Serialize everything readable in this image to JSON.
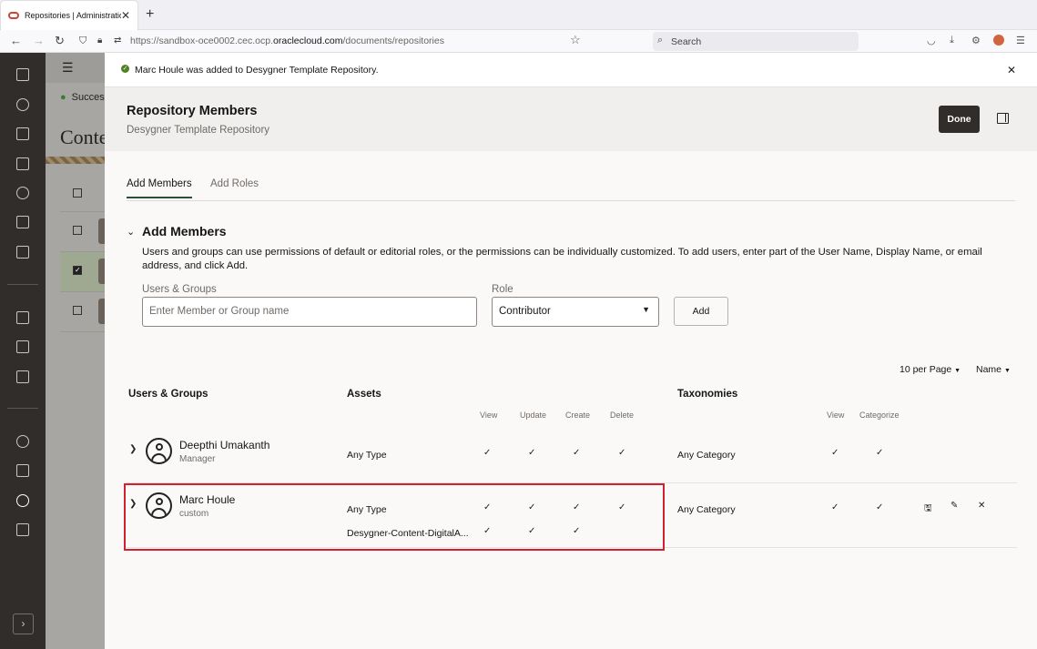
{
  "browser": {
    "tab_title": "Repositories | Administration",
    "url_prefix": "https://sandbox-oce0002.cec.ocp.",
    "url_domain": "oraclecloud.com",
    "url_path": "/documents/repositories",
    "search_placeholder": "Search"
  },
  "background": {
    "success_text": "Success",
    "page_title": "Conte"
  },
  "banner": {
    "message": "Marc Houle was added to Desygner Template Repository."
  },
  "header": {
    "title": "Repository Members",
    "subtitle": "Desygner Template Repository",
    "done_label": "Done"
  },
  "tabs": [
    {
      "label": "Add Members",
      "active": true
    },
    {
      "label": "Add Roles",
      "active": false
    }
  ],
  "add_members": {
    "title": "Add Members",
    "description": "Users and groups can use permissions of default or editorial roles, or the permissions can be individually customized. To add users, enter part of the User Name, Display Name, or email address, and click Add.",
    "users_label": "Users & Groups",
    "users_placeholder": "Enter Member or Group name",
    "role_label": "Role",
    "role_value": "Contributor",
    "add_label": "Add"
  },
  "list_controls": {
    "per_page": "10 per Page",
    "sort": "Name"
  },
  "table": {
    "col_users": "Users & Groups",
    "col_assets": "Assets",
    "col_taxonomies": "Taxonomies",
    "asset_perms": [
      "View",
      "Update",
      "Create",
      "Delete"
    ],
    "tax_perms": [
      "View",
      "Categorize"
    ],
    "rows": [
      {
        "name": "Deepthi Umakanth",
        "role": "Manager",
        "asset_type": "Any Type",
        "taxonomy": "Any Category"
      },
      {
        "name": "Marc Houle",
        "role": "custom",
        "asset_type": "Any Type",
        "asset_type_2": "Desygner-Content-DigitalA...",
        "taxonomy": "Any Category"
      }
    ]
  },
  "colors": {
    "highlight": "#d1202e",
    "success": "#508223",
    "primary_button": "#312d2a"
  }
}
